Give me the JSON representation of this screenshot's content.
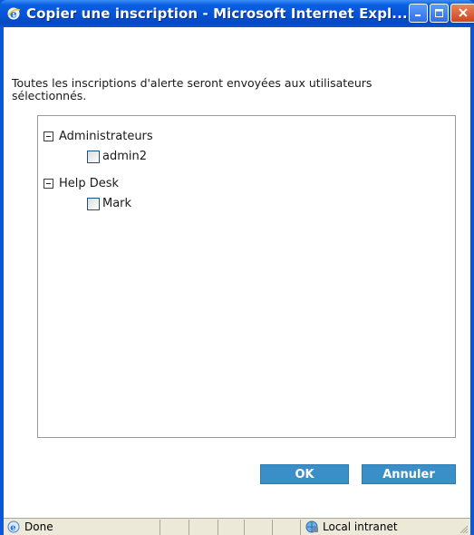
{
  "window": {
    "title": "Copier une inscription - Microsoft Internet Expl...",
    "icon": "ie-icon",
    "controls": [
      "minimize-icon",
      "maximize-icon",
      "close-icon"
    ]
  },
  "dialog": {
    "instruction": "Toutes les inscriptions d'alerte seront envoyées aux utilisateurs sélectionnés.",
    "groups": [
      {
        "label": "Administrateurs",
        "expanded": true,
        "users": [
          {
            "label": "admin2",
            "checked": false
          }
        ]
      },
      {
        "label": "Help Desk",
        "expanded": true,
        "users": [
          {
            "label": "Mark",
            "checked": false
          }
        ]
      }
    ],
    "ok_label": "OK",
    "cancel_label": "Annuler"
  },
  "statusbar": {
    "status": "Done",
    "zone": "Local intranet"
  },
  "colors": {
    "titlebar": "#0553d6",
    "button": "#3b8fc9",
    "statusbar": "#ece9d8"
  }
}
